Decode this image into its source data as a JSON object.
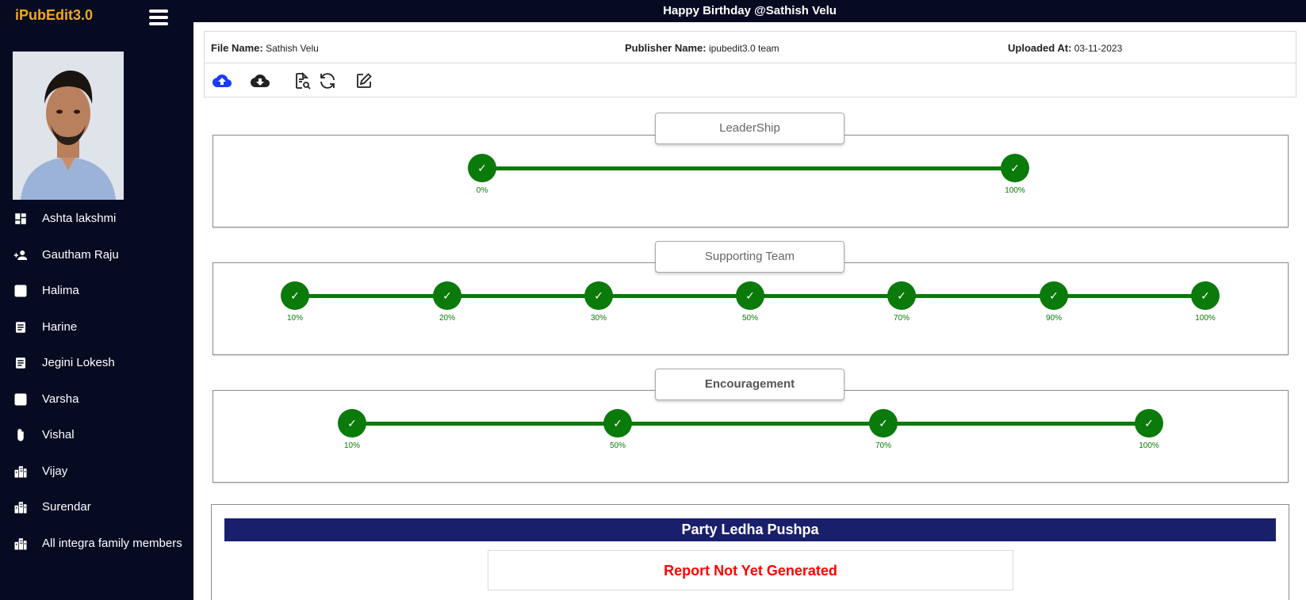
{
  "app": {
    "brand": "iPubEdit3.0"
  },
  "banner": "Happy Birthday @Sathish Velu",
  "sidebar": {
    "items": [
      {
        "label": "Ashta lakshmi",
        "icon": "dashboard-icon"
      },
      {
        "label": "Gautham Raju",
        "icon": "add-person-icon"
      },
      {
        "label": "Halima",
        "icon": "layout-icon"
      },
      {
        "label": "Harine",
        "icon": "document-icon"
      },
      {
        "label": "Jegini Lokesh",
        "icon": "document-icon"
      },
      {
        "label": "Varsha",
        "icon": "layout-icon"
      },
      {
        "label": "Vishal",
        "icon": "paperclip-icon"
      },
      {
        "label": "Vijay",
        "icon": "buildings-icon"
      },
      {
        "label": "Surendar",
        "icon": "buildings-icon"
      },
      {
        "label": "All integra family members",
        "icon": "buildings-icon"
      }
    ]
  },
  "info": {
    "file_name_label": "File Name:",
    "file_name": "Sathish Velu",
    "publisher_label": "Publisher Name:",
    "publisher": "ipubedit3.0 team",
    "uploaded_label": "Uploaded At:",
    "uploaded": "03-11-2023"
  },
  "toolbar": {
    "tools": [
      "cloud-upload-icon",
      "cloud-download-icon",
      "document-search-icon",
      "refresh-icon",
      "edit-icon"
    ]
  },
  "sections": [
    {
      "title": "LeaderShip",
      "steps": [
        "0%",
        "100%"
      ]
    },
    {
      "title": "Supporting Team",
      "steps": [
        "10%",
        "20%",
        "30%",
        "50%",
        "70%",
        "90%",
        "100%"
      ]
    },
    {
      "title": "Encouragement",
      "steps": [
        "10%",
        "50%",
        "70%",
        "100%"
      ]
    }
  ],
  "report": {
    "title": "Party Ledha Pushpa",
    "status": "Report Not Yet Generated",
    "status_color": "#ff0000"
  },
  "colors": {
    "sidebar": "#060b22",
    "accent": "#f5a623",
    "progress": "#0a7a0a",
    "report_bar": "#1a1f6b"
  }
}
